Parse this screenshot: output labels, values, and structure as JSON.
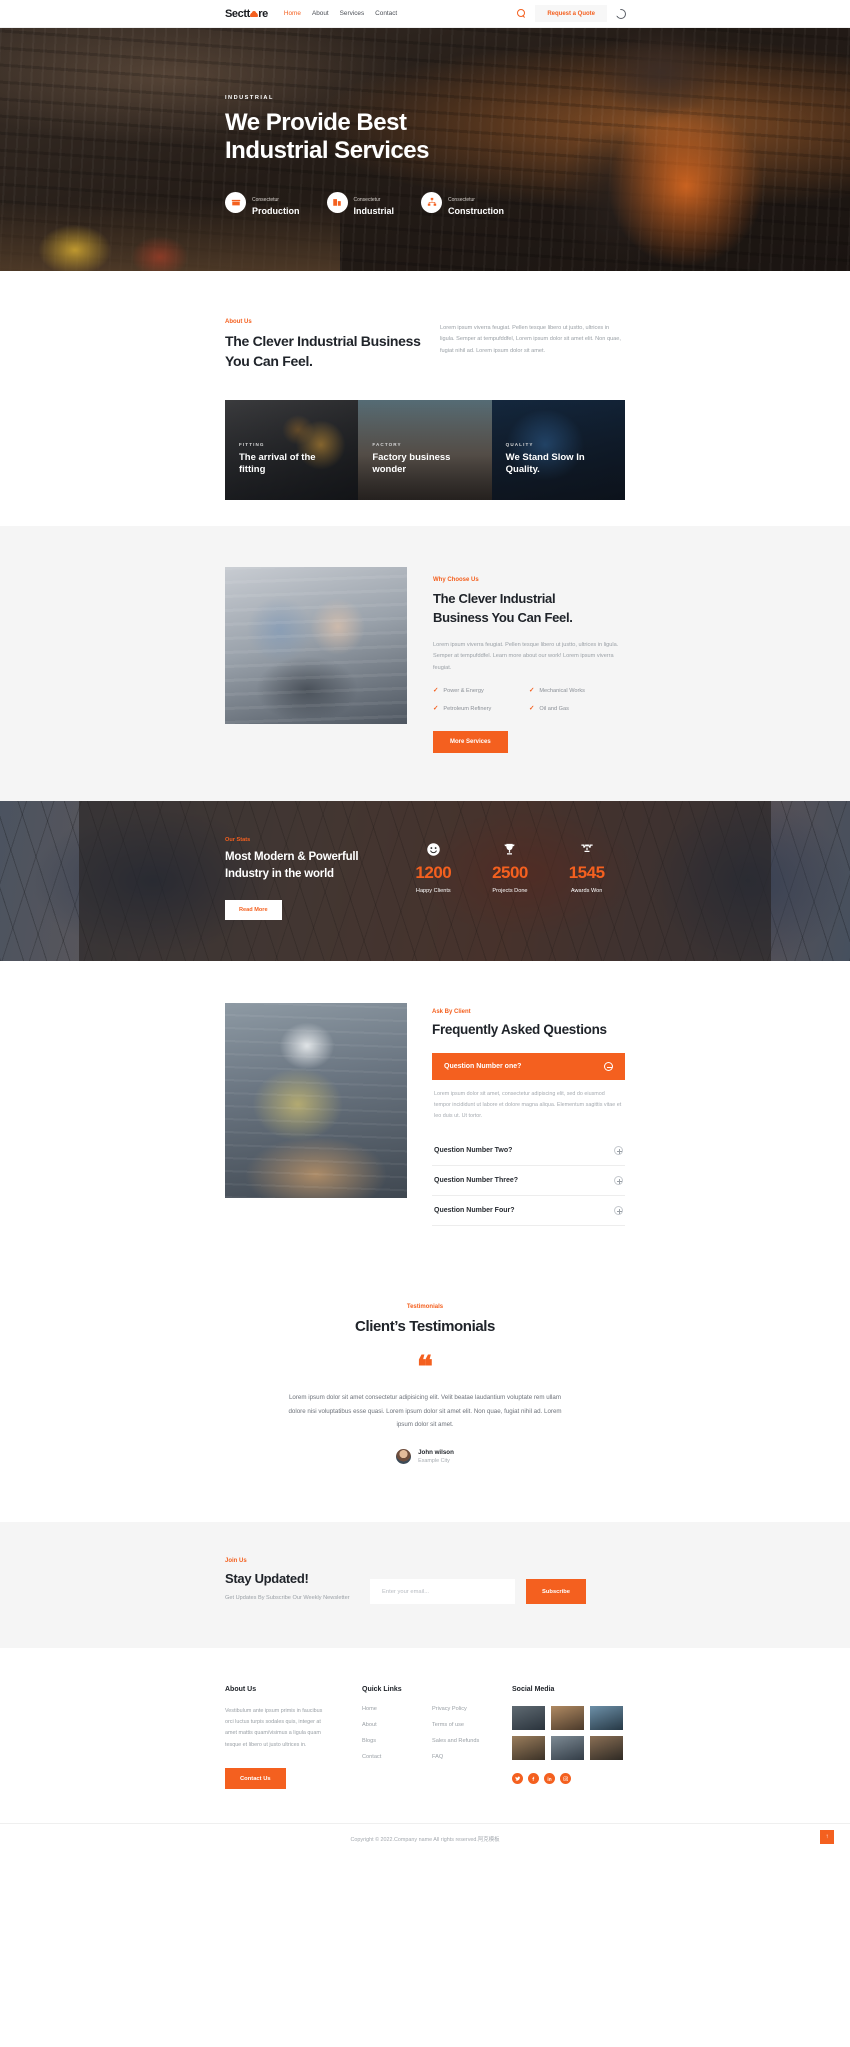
{
  "header": {
    "logo_text_before": "Sectt",
    "logo_text_after": "re",
    "nav": [
      {
        "label": "Home",
        "active": true
      },
      {
        "label": "About",
        "active": false
      },
      {
        "label": "Services",
        "active": false
      },
      {
        "label": "Contact",
        "active": false
      }
    ],
    "quote_button": "Request a Quote",
    "search_icon": "search-icon",
    "theme_icon": "moon-icon"
  },
  "hero": {
    "eyebrow": "INDUSTRIAL",
    "title_line1": "We Provide Best",
    "title_line2": "Industrial Services",
    "badges": [
      {
        "sub": "Consectetur",
        "title": "Production",
        "icon": "box-icon"
      },
      {
        "sub": "Consectetur",
        "title": "Industrial",
        "icon": "building-icon"
      },
      {
        "sub": "Consectetur",
        "title": "Construction",
        "icon": "sitemap-icon"
      }
    ]
  },
  "about": {
    "kicker": "About Us",
    "title_line1": "The Clever Industrial Business",
    "title_line2": "You Can Feel.",
    "paragraph": "Lorem ipsum viverra feugiat. Pellen tesque libero ut justto, ultrices in ligula. Semper at tempufddfel, Lorem ipsum dolor sit amet elit. Non quae, fugiat nihil ad. Lorem ipsum dolor sit amet.",
    "cards": [
      {
        "kicker": "FITTING",
        "title": "The arrival of the fitting"
      },
      {
        "kicker": "FACTORY",
        "title": "Factory business wonder"
      },
      {
        "kicker": "QUALITY",
        "title": "We Stand Slow In Quality."
      }
    ]
  },
  "why": {
    "kicker": "Why Choose Us",
    "title_line1": "The Clever Industrial",
    "title_line2": "Business You Can Feel.",
    "paragraph": "Lorem ipsum viverra feugiat. Pellen tesque libero ut justto, ultrices in ligula. Semper at tempufddfel. Learn more about our work! Lorem ipsum viverra feugiat.",
    "features": [
      "Power & Energy",
      "Mechanical Works",
      "Petroleum Refinery",
      "Oil and Gas"
    ],
    "button": "More Services"
  },
  "stats": {
    "kicker": "Our Stats",
    "title_line1": "Most Modern & Powerfull",
    "title_line2": "Industry in the world",
    "button": "Read More",
    "items": [
      {
        "icon": "smiley-icon",
        "number": "1200",
        "label": "Happy Clients"
      },
      {
        "icon": "trophy-icon",
        "number": "2500",
        "label": "Projects Done"
      },
      {
        "icon": "medal-icon",
        "number": "1545",
        "label": "Awards Won"
      }
    ]
  },
  "faq": {
    "kicker": "Ask By Client",
    "title": "Frequently Asked Questions",
    "open_question": "Question Number one?",
    "open_answer": "Lorem ipsum dolor sit amet, consectetur adipiscing elit, sed do eiusmod tempor incididunt ut labore et dolore magna aliqua. Elementum sagittis vitae et leo duis ut. Ut tortor.",
    "items": [
      "Question Number Two?",
      "Question Number Three?",
      "Question Number Four?"
    ]
  },
  "testimonials": {
    "kicker": "Testimonials",
    "title": "Client’s Testimonials",
    "quote_glyph": "❝",
    "text": "Lorem ipsum dolor sit amet consectetur adipisicing elit. Velit beatae laudantium voluptate rem ullam dolore nisi voluptatibus esse quasi. Lorem ipsum dolor sit amet elit. Non quae, fugiat nihil ad. Lorem ipsum dolor sit amet.",
    "author_name": "John wilson",
    "author_city": "Example City"
  },
  "newsletter": {
    "kicker": "Join Us",
    "title": "Stay Updated!",
    "subtitle": "Get Updates By Subscribe Our Weekly Newsletter",
    "input_placeholder": "Enter your email...",
    "input_value": "",
    "button": "Subscribe"
  },
  "footer": {
    "about_heading": "About Us",
    "about_text": "Vestibulum ante ipsum primis in faucibus orci luctus turpis sodales quis, integer at amet mattis quam/visimus a ligula quam tesque et libero ut justo ultrices in.",
    "contact_button": "Contact Us",
    "links_heading": "Quick Links",
    "links_col1": [
      "Home",
      "About",
      "Blogs",
      "Contact"
    ],
    "links_col2": [
      "Privacy Policy",
      "Terms of use",
      "Sales and Refunds",
      "FAQ"
    ],
    "social_heading": "Social Media",
    "socials": [
      "twitter-icon",
      "facebook-icon",
      "linkedin-icon",
      "instagram-icon"
    ],
    "copyright": "Copyright © 2022.Company name All rights reserved.阿克模板",
    "scroll_top": "↑"
  },
  "colors": {
    "accent": "#f4601f",
    "dark": "#20242a",
    "muted": "#9aa0a6",
    "light_bg": "#f5f5f5"
  }
}
